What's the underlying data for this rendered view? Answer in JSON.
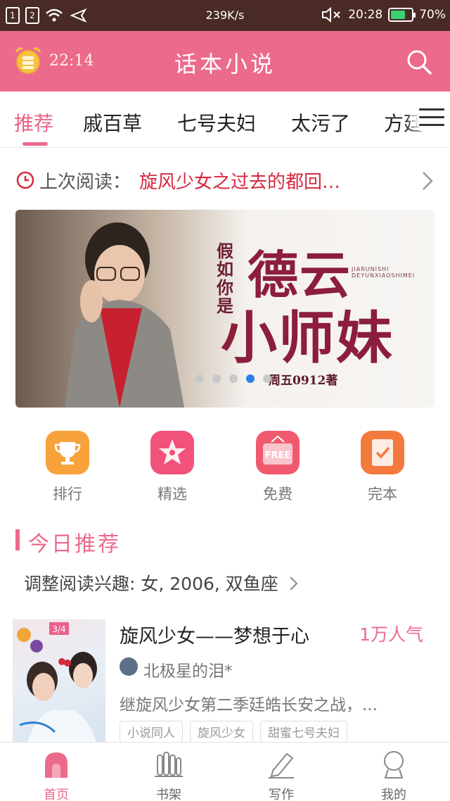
{
  "status_bar": {
    "sim1": "1",
    "sim2": "2",
    "speed": "239K/s",
    "time": "20:28",
    "battery": "70%",
    "battery_level": 0.7
  },
  "header": {
    "timer": "22:14",
    "title": "话本小说",
    "search_icon": "search-icon",
    "alarm_icon": "alarm-clock-icon"
  },
  "tabs": [
    {
      "label": "推荐",
      "active": true
    },
    {
      "label": "戚百草"
    },
    {
      "label": "七号夫妇"
    },
    {
      "label": "太污了"
    },
    {
      "label": "方廷"
    }
  ],
  "last_read": {
    "label": "上次阅读：",
    "title": "旋风少女之过去的都回…"
  },
  "banner": {
    "pre_title": "假如你是",
    "big_line1": "德云",
    "big_line2": "小师妹",
    "subtitle": "JIARUNISHI DEYUNXIAOSHIMEI",
    "author": "周五0912著",
    "slides": 5,
    "active_slide": 4
  },
  "quick_entries": [
    {
      "label": "排行",
      "icon": "trophy-icon",
      "color": "#f7a23b"
    },
    {
      "label": "精选",
      "icon": "star-icon",
      "color": "#f2527a"
    },
    {
      "label": "免费",
      "icon": "free-icon",
      "color": "#f15a6e",
      "icon_text": "FREE"
    },
    {
      "label": "完本",
      "icon": "checklist-icon",
      "color": "#f37a3c"
    }
  ],
  "today": {
    "title": "今日推荐",
    "interest": "调整阅读兴趣: 女, 2006, 双鱼座"
  },
  "book": {
    "title": "旋风少女——梦想于心",
    "popularity": "1万人气",
    "author": "北极星的泪*",
    "description": "继旋风少女第二季廷皓长安之战，...",
    "tags": [
      "小说同人",
      "旋风少女",
      "甜蜜七号夫妇"
    ],
    "cover_text": "3/4"
  },
  "bottom_nav": [
    {
      "label": "首页",
      "icon": "home-icon",
      "active": true
    },
    {
      "label": "书架",
      "icon": "bookshelf-icon"
    },
    {
      "label": "写作",
      "icon": "pen-icon"
    },
    {
      "label": "我的",
      "icon": "profile-icon"
    }
  ]
}
